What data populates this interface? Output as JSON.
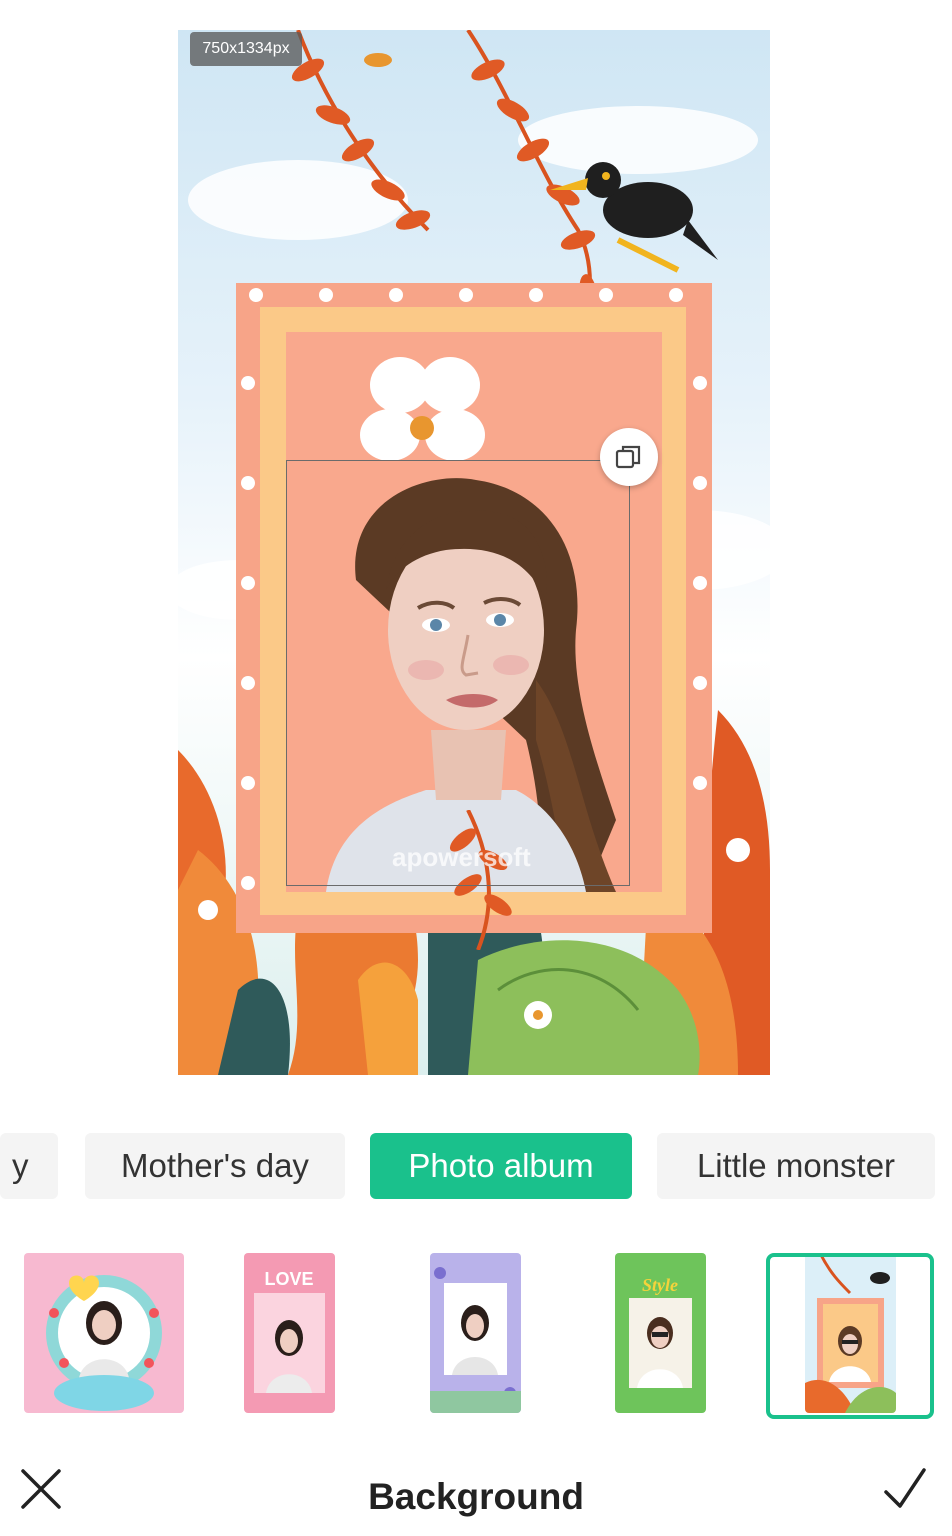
{
  "canvas": {
    "size_label": "750x1334px",
    "watermark": "apowersoft"
  },
  "tabs": [
    {
      "label": "y",
      "active": false
    },
    {
      "label": "Mother's day",
      "active": false
    },
    {
      "label": "Photo album",
      "active": true
    },
    {
      "label": "Little monster",
      "active": false
    }
  ],
  "thumbnails": [
    {
      "name": "heart-frame-template",
      "text": ""
    },
    {
      "name": "love-frame-template",
      "text": "LOVE"
    },
    {
      "name": "lavender-frame-template",
      "text": ""
    },
    {
      "name": "style-frame-template",
      "text": "Style"
    },
    {
      "name": "floral-album-template",
      "text": "",
      "selected": true
    }
  ],
  "bottom_bar": {
    "title": "Background",
    "close_icon": "close-icon",
    "confirm_icon": "check-icon"
  },
  "colors": {
    "accent": "#1ac18c",
    "frame_coral": "#f7a488",
    "frame_yellow": "#fbc988",
    "leaf_orange": "#e8622a",
    "leaf_green": "#8dbf5b"
  }
}
